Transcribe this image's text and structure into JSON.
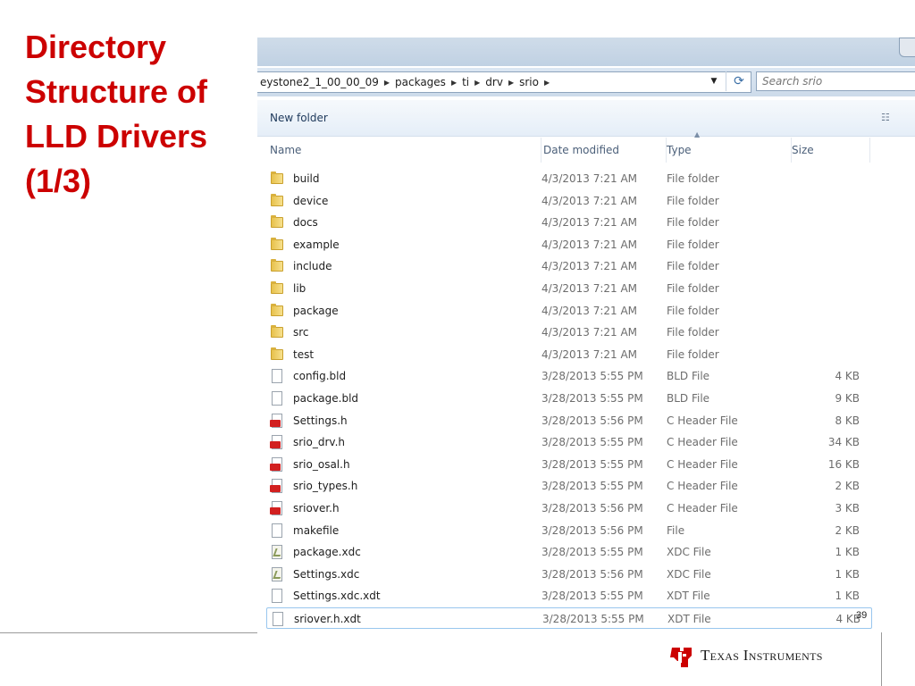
{
  "slide": {
    "title_lines": [
      "Directory",
      "Structure of",
      "LLD Drivers",
      "(1/3)"
    ],
    "page_number": "39",
    "brand": "Texas Instruments"
  },
  "explorer": {
    "breadcrumb": [
      "eystone2_1_00_00_09",
      "packages",
      "ti",
      "drv",
      "srio"
    ],
    "search_placeholder": "Search srio",
    "toolbar": {
      "new_folder": "New folder"
    },
    "columns": {
      "name": "Name",
      "date": "Date modified",
      "type": "Type",
      "size": "Size"
    },
    "rows": [
      {
        "name": "build",
        "date": "4/3/2013 7:21 AM",
        "type": "File folder",
        "size": "",
        "icon": "folder-icon"
      },
      {
        "name": "device",
        "date": "4/3/2013 7:21 AM",
        "type": "File folder",
        "size": "",
        "icon": "folder-icon"
      },
      {
        "name": "docs",
        "date": "4/3/2013 7:21 AM",
        "type": "File folder",
        "size": "",
        "icon": "folder-icon"
      },
      {
        "name": "example",
        "date": "4/3/2013 7:21 AM",
        "type": "File folder",
        "size": "",
        "icon": "folder-icon"
      },
      {
        "name": "include",
        "date": "4/3/2013 7:21 AM",
        "type": "File folder",
        "size": "",
        "icon": "folder-icon"
      },
      {
        "name": "lib",
        "date": "4/3/2013 7:21 AM",
        "type": "File folder",
        "size": "",
        "icon": "folder-icon"
      },
      {
        "name": "package",
        "date": "4/3/2013 7:21 AM",
        "type": "File folder",
        "size": "",
        "icon": "folder-icon"
      },
      {
        "name": "src",
        "date": "4/3/2013 7:21 AM",
        "type": "File folder",
        "size": "",
        "icon": "folder-icon"
      },
      {
        "name": "test",
        "date": "4/3/2013 7:21 AM",
        "type": "File folder",
        "size": "",
        "icon": "folder-icon"
      },
      {
        "name": "config.bld",
        "date": "3/28/2013 5:55 PM",
        "type": "BLD File",
        "size": "4 KB",
        "icon": "file-icon"
      },
      {
        "name": "package.bld",
        "date": "3/28/2013 5:55 PM",
        "type": "BLD File",
        "size": "9 KB",
        "icon": "file-icon"
      },
      {
        "name": "Settings.h",
        "date": "3/28/2013 5:56 PM",
        "type": "C Header File",
        "size": "8 KB",
        "icon": "header-icon"
      },
      {
        "name": "srio_drv.h",
        "date": "3/28/2013 5:55 PM",
        "type": "C Header File",
        "size": "34 KB",
        "icon": "header-icon"
      },
      {
        "name": "srio_osal.h",
        "date": "3/28/2013 5:55 PM",
        "type": "C Header File",
        "size": "16 KB",
        "icon": "header-icon"
      },
      {
        "name": "srio_types.h",
        "date": "3/28/2013 5:55 PM",
        "type": "C Header File",
        "size": "2 KB",
        "icon": "header-icon"
      },
      {
        "name": "sriover.h",
        "date": "3/28/2013 5:56 PM",
        "type": "C Header File",
        "size": "3 KB",
        "icon": "header-icon"
      },
      {
        "name": "makefile",
        "date": "3/28/2013 5:56 PM",
        "type": "File",
        "size": "2 KB",
        "icon": "file-icon"
      },
      {
        "name": "package.xdc",
        "date": "3/28/2013 5:55 PM",
        "type": "XDC File",
        "size": "1 KB",
        "icon": "xdc-icon"
      },
      {
        "name": "Settings.xdc",
        "date": "3/28/2013 5:56 PM",
        "type": "XDC File",
        "size": "1 KB",
        "icon": "xdc-icon"
      },
      {
        "name": "Settings.xdc.xdt",
        "date": "3/28/2013 5:55 PM",
        "type": "XDT File",
        "size": "1 KB",
        "icon": "file-icon"
      },
      {
        "name": "sriover.h.xdt",
        "date": "3/28/2013 5:55 PM",
        "type": "XDT File",
        "size": "4 KB",
        "icon": "file-icon",
        "selected": true
      }
    ]
  },
  "colors": {
    "title_red": "#cc0000",
    "ti_red": "#cc0000"
  }
}
